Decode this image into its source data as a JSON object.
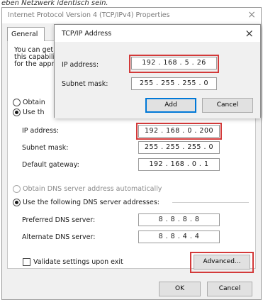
{
  "caption": "eben Netzwerk identisch sein.",
  "main_dialog": {
    "title": "Internet Protocol Version 4 (TCP/IPv4) Properties",
    "close_icon": "×",
    "tab_general": "General",
    "intro_lines": [
      "You can get",
      "this capabili",
      "for the appr"
    ],
    "obtain_ip_label": "Obtain",
    "use_ip_label": "Use th",
    "ip_address_label": "IP address:",
    "ip_address_value": "192 . 168 . 0 . 200",
    "subnet_mask_label": "Subnet mask:",
    "subnet_mask_value": "255 . 255 . 255 . 0",
    "gateway_label": "Default gateway:",
    "gateway_value": "192 . 168 . 0 . 1",
    "obtain_dns_label": "Obtain DNS server address automatically",
    "use_dns_label": "Use the following DNS server addresses:",
    "preferred_dns_label": "Preferred DNS server:",
    "preferred_dns_value": "8 . 8 . 8 . 8",
    "alternate_dns_label": "Alternate DNS server:",
    "alternate_dns_value": "8 . 8 . 4 . 4",
    "validate_label": "Validate settings upon exit",
    "advanced_button": "Advanced...",
    "ok_button": "OK",
    "cancel_button": "Cancel",
    "highlight_color": "#d33a3a"
  },
  "popup": {
    "title": "TCP/IP Address",
    "close_icon": "×",
    "ip_label": "IP address:",
    "ip_value": "192 . 168 . 5 . 26",
    "subnet_label": "Subnet mask:",
    "subnet_value": "255 . 255 . 255 . 0",
    "add_button": "Add",
    "cancel_button": "Cancel",
    "focus_color": "#0078d7"
  }
}
